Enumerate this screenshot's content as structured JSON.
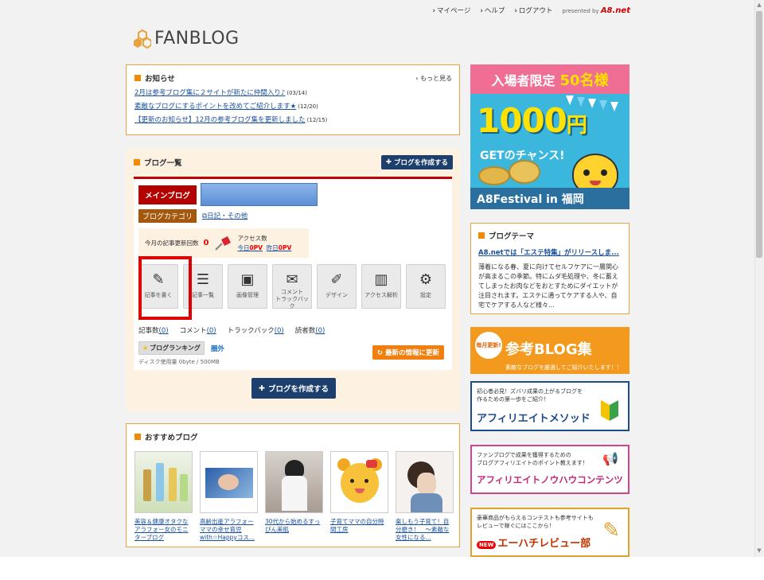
{
  "topnav": {
    "mypage": "マイページ",
    "help": "ヘルプ",
    "logout": "ログアウト",
    "presented": "presented by",
    "presented_brand": "A8.net"
  },
  "logo": {
    "text": "FANBLOG"
  },
  "news": {
    "heading": "お知らせ",
    "more": "もっと見る",
    "items": [
      {
        "text": "2月は参考ブログ集に２サイトが新たに仲間入り♪",
        "date": "(03/14)"
      },
      {
        "text": "素敵なブログにするポイントを改めてご紹介します★",
        "date": "(12/20)"
      },
      {
        "text": "【更新のお知らせ】12月の参考ブログ集を更新しました",
        "date": "(12/15)"
      }
    ]
  },
  "bloglist": {
    "heading": "ブログ一覧",
    "create_small": "ブログを作成する",
    "main_tag": "メインブログ",
    "category_tag": "ブログカテゴリ",
    "category_link": "日記・その他",
    "monthly_updates_label": "今月の記事更新回数",
    "monthly_updates_count": "0",
    "access_label": "アクセス数",
    "today_label": "今日",
    "today_pv": "0PV",
    "yesterday_label": "昨日",
    "yesterday_pv": "0PV",
    "tools": [
      {
        "label": "記事を書く",
        "icon": "write-icon"
      },
      {
        "label": "記事一覧",
        "icon": "article-list-icon"
      },
      {
        "label": "画像管理",
        "icon": "image-icon"
      },
      {
        "label": "コメント\nトラックバック",
        "icon": "comment-icon"
      },
      {
        "label": "デザイン",
        "icon": "brush-icon"
      },
      {
        "label": "アクセス解析",
        "icon": "bar-chart-icon"
      },
      {
        "label": "設定",
        "icon": "gear-icon"
      }
    ],
    "counts": {
      "articles_label": "記事数",
      "articles": "(0)",
      "comments_label": "コメント",
      "comments": "(0)",
      "trackbacks_label": "トラックバック",
      "trackbacks": "(0)",
      "readers_label": "読者数",
      "readers": "(0)"
    },
    "ranking_label": "ブログランキング",
    "ranking_value": "圏外",
    "disk_usage": "ディスク使用量 0byte / 500MB",
    "update_button": "最新の情報に更新",
    "create_big": "ブログを作成する"
  },
  "recommend": {
    "heading": "おすすめブログ",
    "items": [
      {
        "title": "美容＆健康オタクなアラフォー女のモニターブログ"
      },
      {
        "title": "高齢出産アラフォーママの幸せ育児with☆Happyコス..."
      },
      {
        "title": "30代から始めるすっぴん美肌"
      },
      {
        "title": "子育てママの自分時間工房"
      },
      {
        "title": "楽しもう子育て！自分磨き！　～素敵な女性になる..."
      }
    ]
  },
  "sidebar": {
    "main_banner": {
      "top_text": "入場者限定",
      "top_count": "50名様",
      "big": "1000",
      "big_unit": "円",
      "sub": "GETのチャンス!",
      "foot": "A8Festival in 福岡"
    },
    "theme": {
      "heading": "ブログテーマ",
      "link": "A8.netでは「エステ特集」がリリースしま...",
      "text": "薄着になる春、夏に向けてセルフケアに一層関心が高まるこの季節。特にムダ毛処理や、冬に蓄えてしまったお肉などをおとすためにダイエットが注目されます。エステに通ってケアする人や、自宅でケアする人など様々..."
    },
    "ref_banner": {
      "badge": "毎月更新!",
      "title": "参考BLOG集",
      "sub": "素敵なブログを厳選してご紹介いたします！！"
    },
    "aff_banner": {
      "small": "初心者必見！ズバリ成果の上がるブログを\n作るための第一歩をご紹介！",
      "big": "アフィリエイトメソッド"
    },
    "know_banner": {
      "small": "ファンブログで成果を獲得するための\nブログアフィリエイトのポイント教えます！",
      "big": "アフィリエイトノウハウコンテンツ"
    },
    "review_banner": {
      "small": "豪華商品がもらえるコンテストも参考サイトも\nレビューで稼ぐにはここから！",
      "new": "NEW",
      "big": "エーハチレビュー部"
    }
  },
  "colors": {
    "accent": "#f08a00",
    "navy": "#1c3f6e",
    "red": "#b30000"
  }
}
